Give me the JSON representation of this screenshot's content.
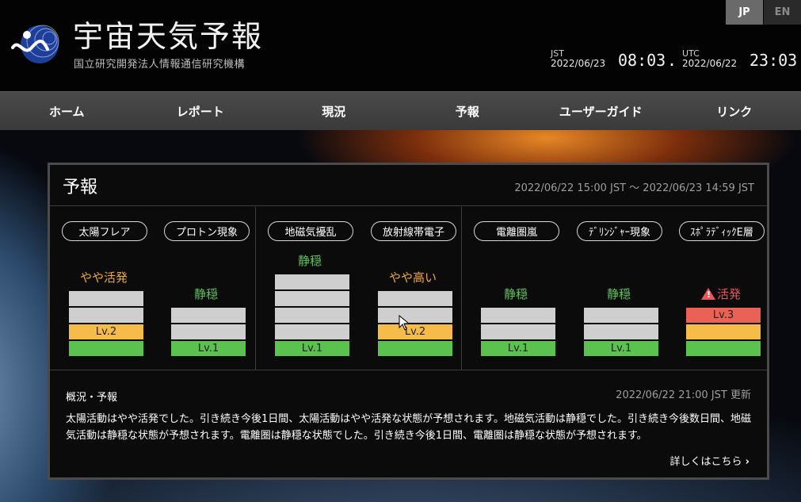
{
  "header": {
    "site_title": "宇宙天気予報",
    "org_name": "国立研究開発法人情報通信研究機構",
    "lang_jp": "JP",
    "lang_en": "EN",
    "jst_zone": "JST",
    "jst_date": "2022/06/23",
    "jst_time": "08:03",
    "utc_zone": "UTC",
    "utc_date": "2022/06/22",
    "utc_time": "23:03"
  },
  "nav": [
    "ホーム",
    "レポート",
    "現況",
    "予報",
    "ユーザーガイド",
    "リンク"
  ],
  "panel": {
    "title": "予報",
    "period": "2022/06/22 15:00 JST 〜 2022/06/23 14:59 JST"
  },
  "items": [
    {
      "name": "太陽フレア",
      "status": "やや活発",
      "status_color": "#f0a83c",
      "level": 2,
      "label": "Lv.2",
      "max_level": 4
    },
    {
      "name": "プロトン現象",
      "status": "静穏",
      "status_color": "#5fc25b",
      "level": 1,
      "label": "Lv.1",
      "max_level": 3
    },
    {
      "name": "地磁気擾乱",
      "status": "静穏",
      "status_color": "#5fc25b",
      "level": 1,
      "label": "Lv.1",
      "max_level": 5
    },
    {
      "name": "放射線帯電子",
      "status": "やや高い",
      "status_color": "#f0a83c",
      "level": 2,
      "label": "Lv.2",
      "max_level": 4
    },
    {
      "name": "電離圏嵐",
      "status": "静穏",
      "status_color": "#5fc25b",
      "level": 1,
      "label": "Lv.1",
      "max_level": 3
    },
    {
      "name": "ﾃﾞﾘﾝｼﾞｬｰ現象",
      "status": "静穏",
      "status_color": "#5fc25b",
      "level": 1,
      "label": "Lv.1",
      "max_level": 3
    },
    {
      "name": "ｽﾎﾟﾗﾃﾞｨｯｸE層",
      "status": "活発",
      "status_color": "#e8585b",
      "level": 3,
      "label": "Lv.3",
      "max_level": 3,
      "warning_icon": "warning-triangle-icon"
    }
  ],
  "level_colors": {
    "1": "#5cc24f",
    "2": "#f6bc4a",
    "3": "#ea6256",
    "empty": "#cfcfcf"
  },
  "summary": {
    "title": "概況・予報",
    "updated": "2022/06/22 21:00 JST 更新",
    "text": "太陽活動はやや活発でした。引き続き今後1日間、太陽活動はやや活発な状態が予想されます。地磁気活動は静穏でした。引き続き今後数日間、地磁気活動は静穏な状態が予想されます。電離圏は静穏な状態でした。引き続き今後1日間、電離圏は静穏な状態が予想されます。",
    "more_link": "詳しくはこちら"
  }
}
